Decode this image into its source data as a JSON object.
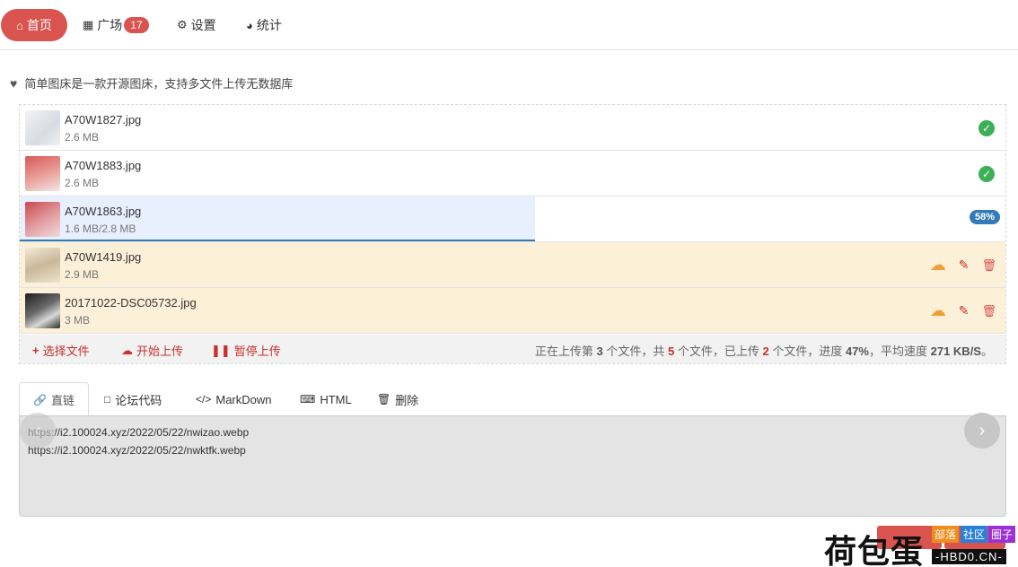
{
  "nav": {
    "items": [
      {
        "label": "首页",
        "icon": "home-icon",
        "active": true
      },
      {
        "label": "广场",
        "icon": "grid-icon",
        "badge": "17"
      },
      {
        "label": "设置",
        "icon": "gears-icon"
      },
      {
        "label": "统计",
        "icon": "pie-chart-icon"
      }
    ]
  },
  "intro": {
    "text": "简单图床是一款开源图床，支持多文件上传无数据库"
  },
  "files": [
    {
      "name": "A70W1827.jpg",
      "size": "2.6 MB",
      "status": "done"
    },
    {
      "name": "A70W1883.jpg",
      "size": "2.6 MB",
      "status": "done"
    },
    {
      "name": "A70W1863.jpg",
      "size": "1.6 MB/2.8 MB",
      "status": "uploading",
      "progress": "58%",
      "progress_value": 0.523
    },
    {
      "name": "A70W1419.jpg",
      "size": "2.9 MB",
      "status": "pending"
    },
    {
      "name": "20171022-DSC05732.jpg",
      "size": "3 MB",
      "status": "pending"
    }
  ],
  "toolbar": {
    "select_label": "选择文件",
    "start_label": "开始上传",
    "pause_label": "暂停上传",
    "status": {
      "p1": "正在上传第 ",
      "current": "3",
      "p2": " 个文件，共 ",
      "total": "5",
      "p3": " 个文件，已上传 ",
      "uploaded": "2",
      "p4": " 个文件，进度 ",
      "progress": "47%",
      "p5": "，平均速度 ",
      "speed": "271 KB/S",
      "p6": "。"
    }
  },
  "tabs": [
    {
      "label": "直链",
      "icon": "link-icon",
      "active": true
    },
    {
      "label": "论坛代码",
      "icon": "comment-icon"
    },
    {
      "label": "MarkDown",
      "icon": "code-icon"
    },
    {
      "label": "HTML",
      "icon": "html5-icon"
    },
    {
      "label": "删除",
      "icon": "trash-icon"
    }
  ],
  "links": {
    "value": "https://i2.100024.xyz/2022/05/22/nwizao.webp\nhttps://i2.100024.xyz/2022/05/22/nwktfk.webp"
  },
  "watermark": {
    "main": "荷包蛋",
    "tag1": "部落",
    "tag2": "社区",
    "tag3": "圈子",
    "sub": "-HBD0.CN-"
  },
  "colors": {
    "accent": "#d9534f",
    "success": "#3cb055",
    "primary": "#337ab7",
    "pending_bg": "#fdf0d8"
  }
}
